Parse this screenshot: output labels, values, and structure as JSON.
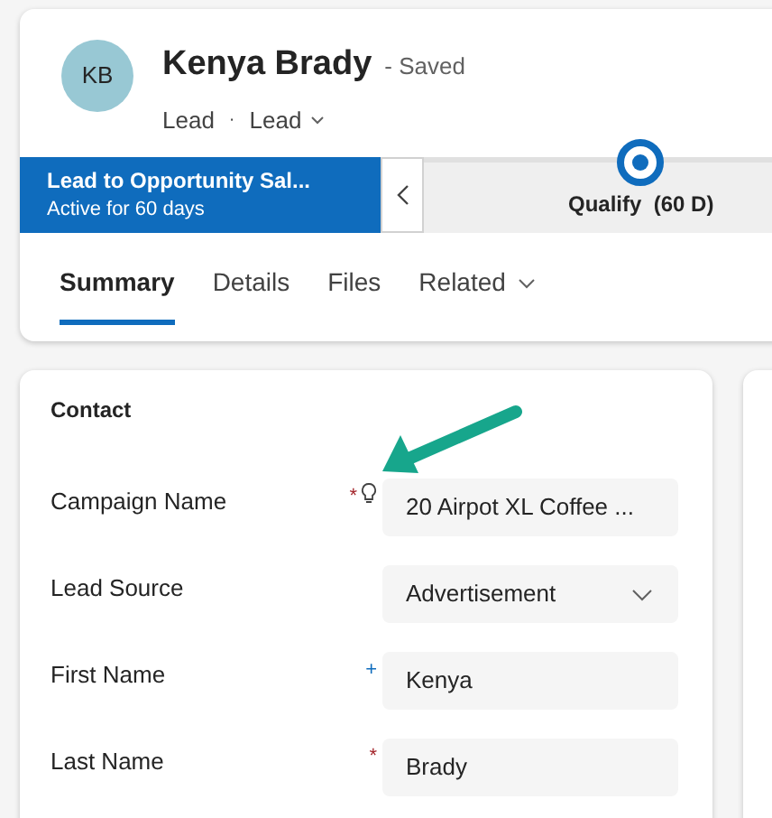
{
  "header": {
    "avatar_initials": "KB",
    "name": "Kenya Brady",
    "save_status": "- Saved",
    "entity": "Lead",
    "separator": "·",
    "form": "Lead"
  },
  "process": {
    "name": "Lead to Opportunity Sal...",
    "duration": "Active for 60 days",
    "stage": "Qualify",
    "stage_duration": "(60 D)"
  },
  "tabs": [
    {
      "label": "Summary",
      "selected": true
    },
    {
      "label": "Details",
      "selected": false
    },
    {
      "label": "Files",
      "selected": false
    },
    {
      "label": "Related",
      "selected": false,
      "dropdown": true
    }
  ],
  "section": {
    "title": "Contact",
    "fields": [
      {
        "label": "Campaign Name",
        "marker": "*",
        "color": "#a4262c",
        "suggestion": true,
        "kind": "text",
        "value": "20 Airpot XL Coffee ..."
      },
      {
        "label": "Lead Source",
        "kind": "select",
        "value": "Advertisement"
      },
      {
        "label": "First Name",
        "marker": "+",
        "color": "#0f6cbd",
        "kind": "text",
        "value": "Kenya"
      },
      {
        "label": "Last Name",
        "marker": "*",
        "color": "#a4262c",
        "kind": "text",
        "value": "Brady"
      }
    ]
  }
}
